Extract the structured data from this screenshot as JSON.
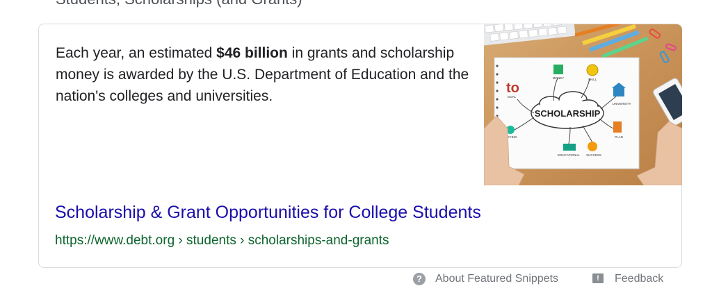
{
  "cutoff_text": "Students, Scholarships (and Grants)",
  "snippet": {
    "text_before": "Each year, an estimated ",
    "bold": "$46 billion",
    "text_after": " in grants and scholarship money is awarded by the U.S. Department of Education and the nation's colleges and universities."
  },
  "image": {
    "center_word": "SCHOLARSHIP",
    "labels": [
      "MONEY",
      "SKILL",
      "UNIVERSITY",
      "PLAN",
      "SUCCESS",
      "EDUCATIONAL",
      "STUDYING",
      "GOAL"
    ],
    "goal_graphic": "to"
  },
  "result": {
    "title": "Scholarship & Grant Opportunities for College Students",
    "url": "https://www.debt.org › students › scholarships-and-grants"
  },
  "footer": {
    "about_label": "About Featured Snippets",
    "feedback_label": "Feedback",
    "help_icon_glyph": "?",
    "feedback_icon_glyph": "!"
  },
  "colors": {
    "link": "#1a0dab",
    "url": "#0d652d",
    "border": "#dadce0",
    "muted": "#70757a"
  }
}
